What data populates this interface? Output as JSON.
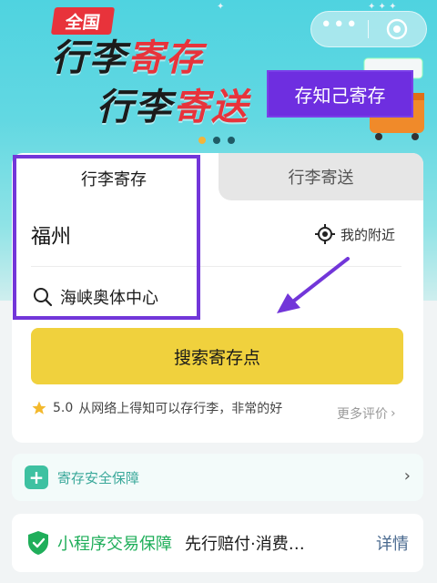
{
  "banner": {
    "badge": "全国",
    "headline_line1_dark": "行李",
    "headline_line1_red": "寄存",
    "headline_line2_dark": "行李",
    "headline_line2_red": "寄送",
    "store_button": "存知己寄存",
    "pager_count": 3,
    "pager_active": 0
  },
  "capsule": {
    "more_glyph": "•••"
  },
  "tabs": {
    "active": "行李寄存",
    "inactive": "行李寄送"
  },
  "form": {
    "city": "福州",
    "nearby_label": "我的附近",
    "search_value": "海峡奥体中心",
    "search_button": "搜索寄存点"
  },
  "rating": {
    "score": "5.0",
    "review": "从网络上得知可以存行李，非常的好",
    "more_reviews": "更多评价"
  },
  "safety": {
    "label": "寄存安全保障"
  },
  "guarantee": {
    "title": "小程序交易保障",
    "desc": "先行赔付·消费…",
    "detail": "详情"
  },
  "colors": {
    "accent_purple": "#7236d9",
    "button_yellow": "#f0d13d",
    "brand_red": "#e8333b",
    "green": "#1fae5a"
  }
}
